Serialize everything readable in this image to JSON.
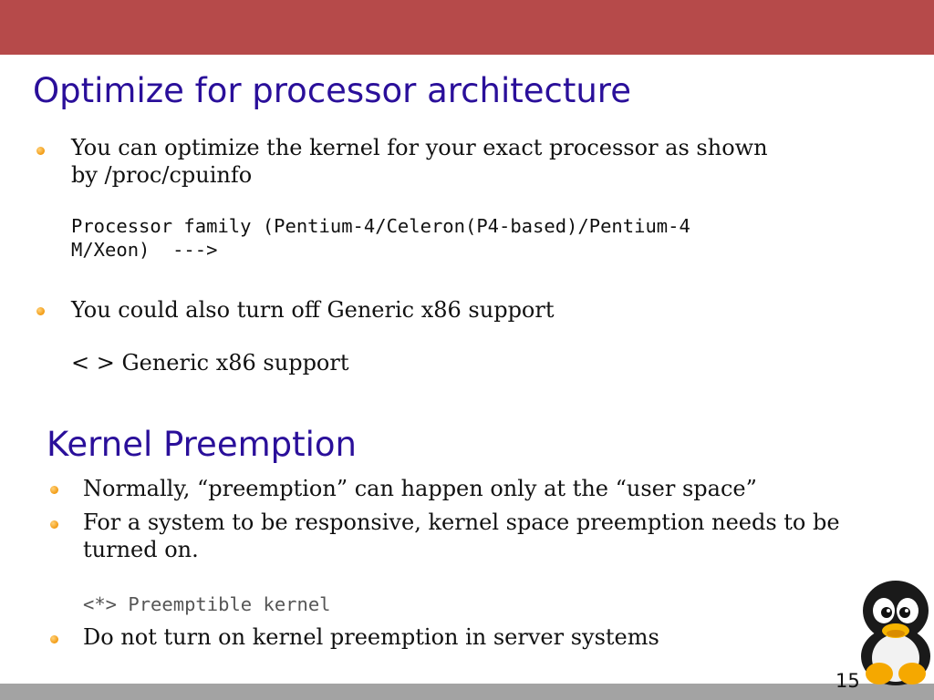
{
  "slide": {
    "page_number": "15",
    "section1": {
      "title": "Optimize for processor architecture",
      "bullet1": {
        "line1": "You can optimize the kernel for your exact processor as shown",
        "line2": "by /proc/cpuinfo",
        "code_line1": "Processor family (Pentium-4/Celeron(P4-based)/Pentium-4",
        "code_line2": "M/Xeon)  --->"
      },
      "bullet2": {
        "line1": "You could also turn off Generic x86 support",
        "sub": "< > Generic x86 support"
      }
    },
    "section2": {
      "title": "Kernel Preemption",
      "bullet1": "Normally, “preemption” can happen only at the “user space”",
      "bullet2": {
        "line1": "For a system to be responsive, kernel space preemption needs to be",
        "line2": "turned on.",
        "code": "<*> Preemptible kernel"
      },
      "bullet3": "Do not turn on kernel preemption in server systems"
    },
    "mascot_icon": "tux-penguin-icon",
    "colors": {
      "header_bar": "#b64a4a",
      "footer_bar": "#a3a3a3",
      "title": "#2a0f9a",
      "bullet": "#f29a12"
    }
  }
}
